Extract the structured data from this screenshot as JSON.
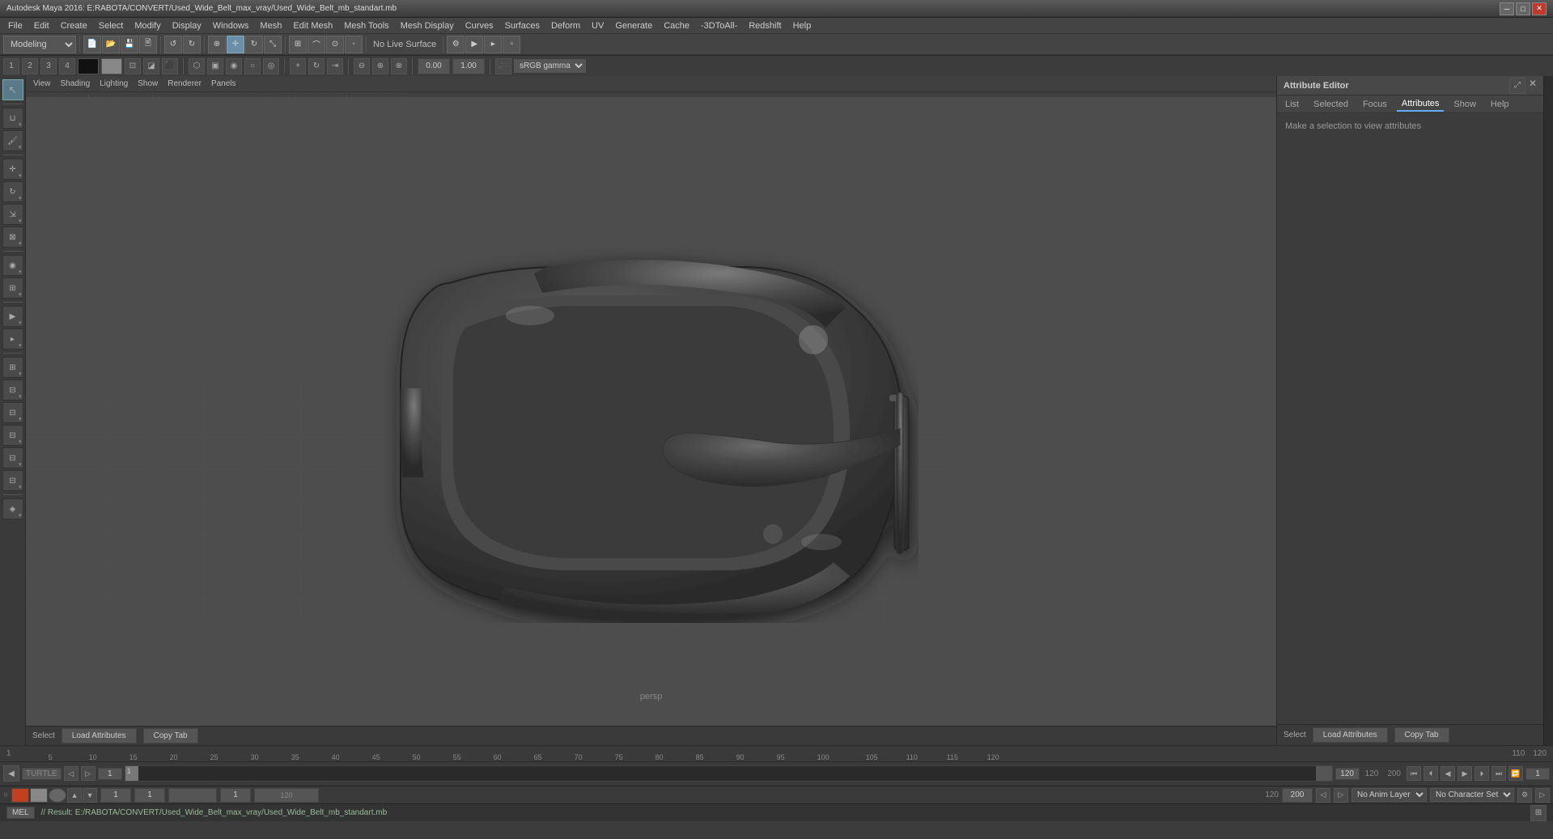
{
  "window": {
    "title": "Autodesk Maya 2016: E:RABOTA/CONVERT/Used_Wide_Belt_max_vray/Used_Wide_Belt_mb_standart.mb",
    "close_btn": "✕",
    "min_btn": "─",
    "max_btn": "□"
  },
  "menu": {
    "items": [
      "File",
      "Edit",
      "Create",
      "Select",
      "Modify",
      "Display",
      "Windows",
      "Mesh",
      "Edit Mesh",
      "Mesh Tools",
      "Mesh Display",
      "Curves",
      "Surfaces",
      "Deform",
      "UV",
      "Generate",
      "Cache",
      "-3DToAll-",
      "Redshift",
      "Help"
    ]
  },
  "toolbar": {
    "modeling_dropdown": "Modeling",
    "no_live_surface": "No Live Surface"
  },
  "viewport": {
    "menu_items": [
      "View",
      "Shading",
      "Lighting",
      "Show",
      "Renderer",
      "Panels"
    ],
    "label": "persp",
    "select_btn": "Select",
    "load_attrs_btn": "Load Attributes",
    "copy_tab_btn": "Copy Tab"
  },
  "attr_editor": {
    "title": "Attribute Editor",
    "close_btn": "✕",
    "tabs": [
      "List",
      "Selected",
      "Focus",
      "Attributes",
      "Show",
      "Help"
    ],
    "message": "Make a selection to view attributes"
  },
  "timeline": {
    "start_frame": "1",
    "end_frame": "120",
    "current_frame": "1",
    "ticks": [
      "5",
      "10",
      "15",
      "20",
      "25",
      "30",
      "35",
      "40",
      "45",
      "50",
      "55",
      "60",
      "65",
      "70",
      "75",
      "80",
      "85",
      "90",
      "95",
      "100",
      "105",
      "110",
      "115",
      "120"
    ]
  },
  "status_bar": {
    "mel_label": "MEL",
    "turtle_label": "TURTLE",
    "result_text": "// Result: E:/RABOTA/CONVERT/Used_Wide_Belt_max_vray/Used_Wide_Belt_mb_standart.mb"
  },
  "animation": {
    "no_anim_layer": "No Anim Layer",
    "no_character_set": "No Character Set",
    "start_num": "1",
    "end_num": "120",
    "start2": "1",
    "end2": "200"
  },
  "channel": {
    "val1": "0.00",
    "val2": "1.00",
    "gamma": "sRGB gamma"
  }
}
